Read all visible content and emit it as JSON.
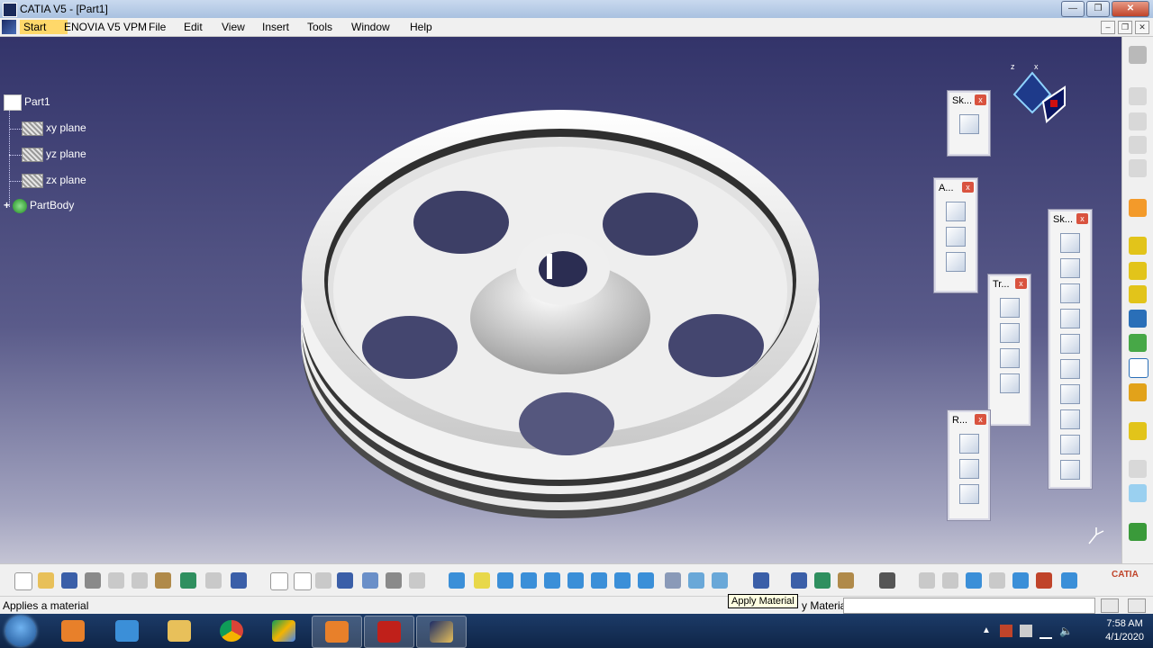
{
  "window": {
    "title": "CATIA V5 - [Part1]"
  },
  "menu": {
    "items": [
      "Start",
      "ENOVIA V5 VPM",
      "File",
      "Edit",
      "View",
      "Insert",
      "Tools",
      "Window",
      "Help"
    ]
  },
  "tree": {
    "root": "Part1",
    "children": [
      "xy plane",
      "yz plane",
      "zx plane",
      "PartBody"
    ]
  },
  "panels": {
    "sketcher": "Sk...",
    "annotations": "A...",
    "transformations": "Tr...",
    "reference": "R...",
    "sketch_based": "Sk..."
  },
  "status": {
    "message": "Applies a material",
    "command_label": "y Material",
    "tooltip": "Apply Material"
  },
  "clock": {
    "time": "7:58 AM",
    "date": "4/1/2020"
  },
  "brand": {
    "logo": "CATIA"
  }
}
